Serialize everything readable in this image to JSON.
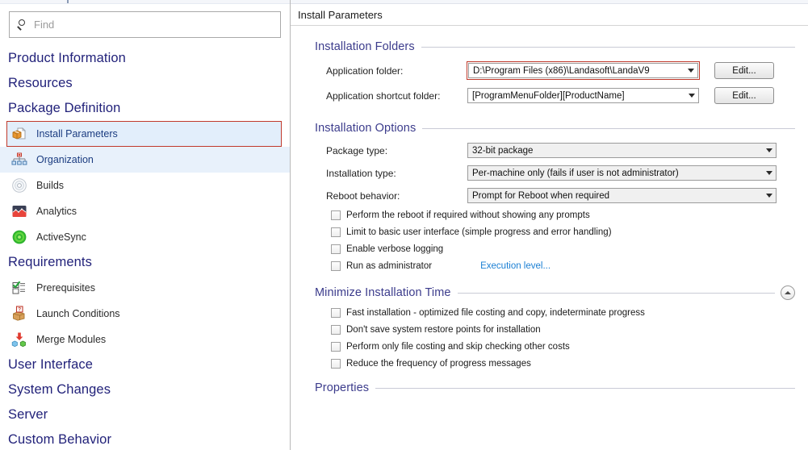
{
  "sidebar": {
    "search": {
      "placeholder": "Find",
      "value": "",
      "icon": "search-icon"
    },
    "groups": [
      {
        "header": "Product Information",
        "items": []
      },
      {
        "header": "Resources",
        "items": []
      },
      {
        "header": "Package Definition",
        "items": [
          {
            "label": "Install Parameters",
            "icon": "package-box-icon",
            "state": "selected"
          },
          {
            "label": "Organization",
            "icon": "org-chart-icon",
            "state": "hovered"
          },
          {
            "label": "Builds",
            "icon": "disc-icon",
            "state": "normal"
          },
          {
            "label": "Analytics",
            "icon": "analytics-chart-icon",
            "state": "normal"
          },
          {
            "label": "ActiveSync",
            "icon": "activesync-icon",
            "state": "normal"
          }
        ]
      },
      {
        "header": "Requirements",
        "items": [
          {
            "label": "Prerequisites",
            "icon": "checklist-icon",
            "state": "normal"
          },
          {
            "label": "Launch Conditions",
            "icon": "question-box-icon",
            "state": "normal"
          },
          {
            "label": "Merge Modules",
            "icon": "merge-modules-icon",
            "state": "normal"
          }
        ]
      },
      {
        "header": "User Interface",
        "items": []
      },
      {
        "header": "System Changes",
        "items": []
      },
      {
        "header": "Server",
        "items": []
      },
      {
        "header": "Custom Behavior",
        "items": []
      }
    ]
  },
  "main": {
    "header_title": "Install Parameters",
    "sections": [
      {
        "title": "Installation Folders",
        "collapsible": false,
        "rows": [
          {
            "label": "Application folder:",
            "value": "D:\\Program Files (x86)\\Landasoft\\LandaV9",
            "highlighted": true,
            "button": "Edit..."
          },
          {
            "label": "Application shortcut folder:",
            "value": "[ProgramMenuFolder][ProductName]",
            "highlighted": false,
            "button": "Edit..."
          }
        ]
      },
      {
        "title": "Installation Options",
        "collapsible": false,
        "rows": [
          {
            "label": "Package type:",
            "value": "32-bit package"
          },
          {
            "label": "Installation type:",
            "value": "Per-machine only (fails if user is not administrator)"
          },
          {
            "label": "Reboot behavior:",
            "value": "Prompt for Reboot when required"
          }
        ],
        "checkboxes": [
          {
            "label": "Perform the reboot if required without showing any prompts",
            "checked": false
          },
          {
            "label": "Limit to basic user interface (simple progress and error handling)",
            "checked": false
          },
          {
            "label": "Enable verbose logging",
            "checked": false
          },
          {
            "label": "Run as administrator",
            "checked": false,
            "link": "Execution level..."
          }
        ]
      },
      {
        "title": "Minimize Installation Time",
        "collapsible": true,
        "rows": [],
        "checkboxes": [
          {
            "label": "Fast installation - optimized file costing and copy, indeterminate progress",
            "checked": false
          },
          {
            "label": "Don't save system restore points for installation",
            "checked": false
          },
          {
            "label": "Perform only file costing and skip checking other costs",
            "checked": false
          },
          {
            "label": "Reduce the frequency of progress messages",
            "checked": false
          }
        ]
      },
      {
        "title": "Properties",
        "collapsible": false,
        "rows": [],
        "checkboxes": []
      }
    ]
  },
  "colors": {
    "section_header": "#3c3c8c",
    "sidebar_header": "#22227a",
    "selection_outline": "#c0392b",
    "selection_fill": "#e2eefb",
    "hover_fill": "#e8f1fb",
    "link": "#1a7fd4"
  }
}
